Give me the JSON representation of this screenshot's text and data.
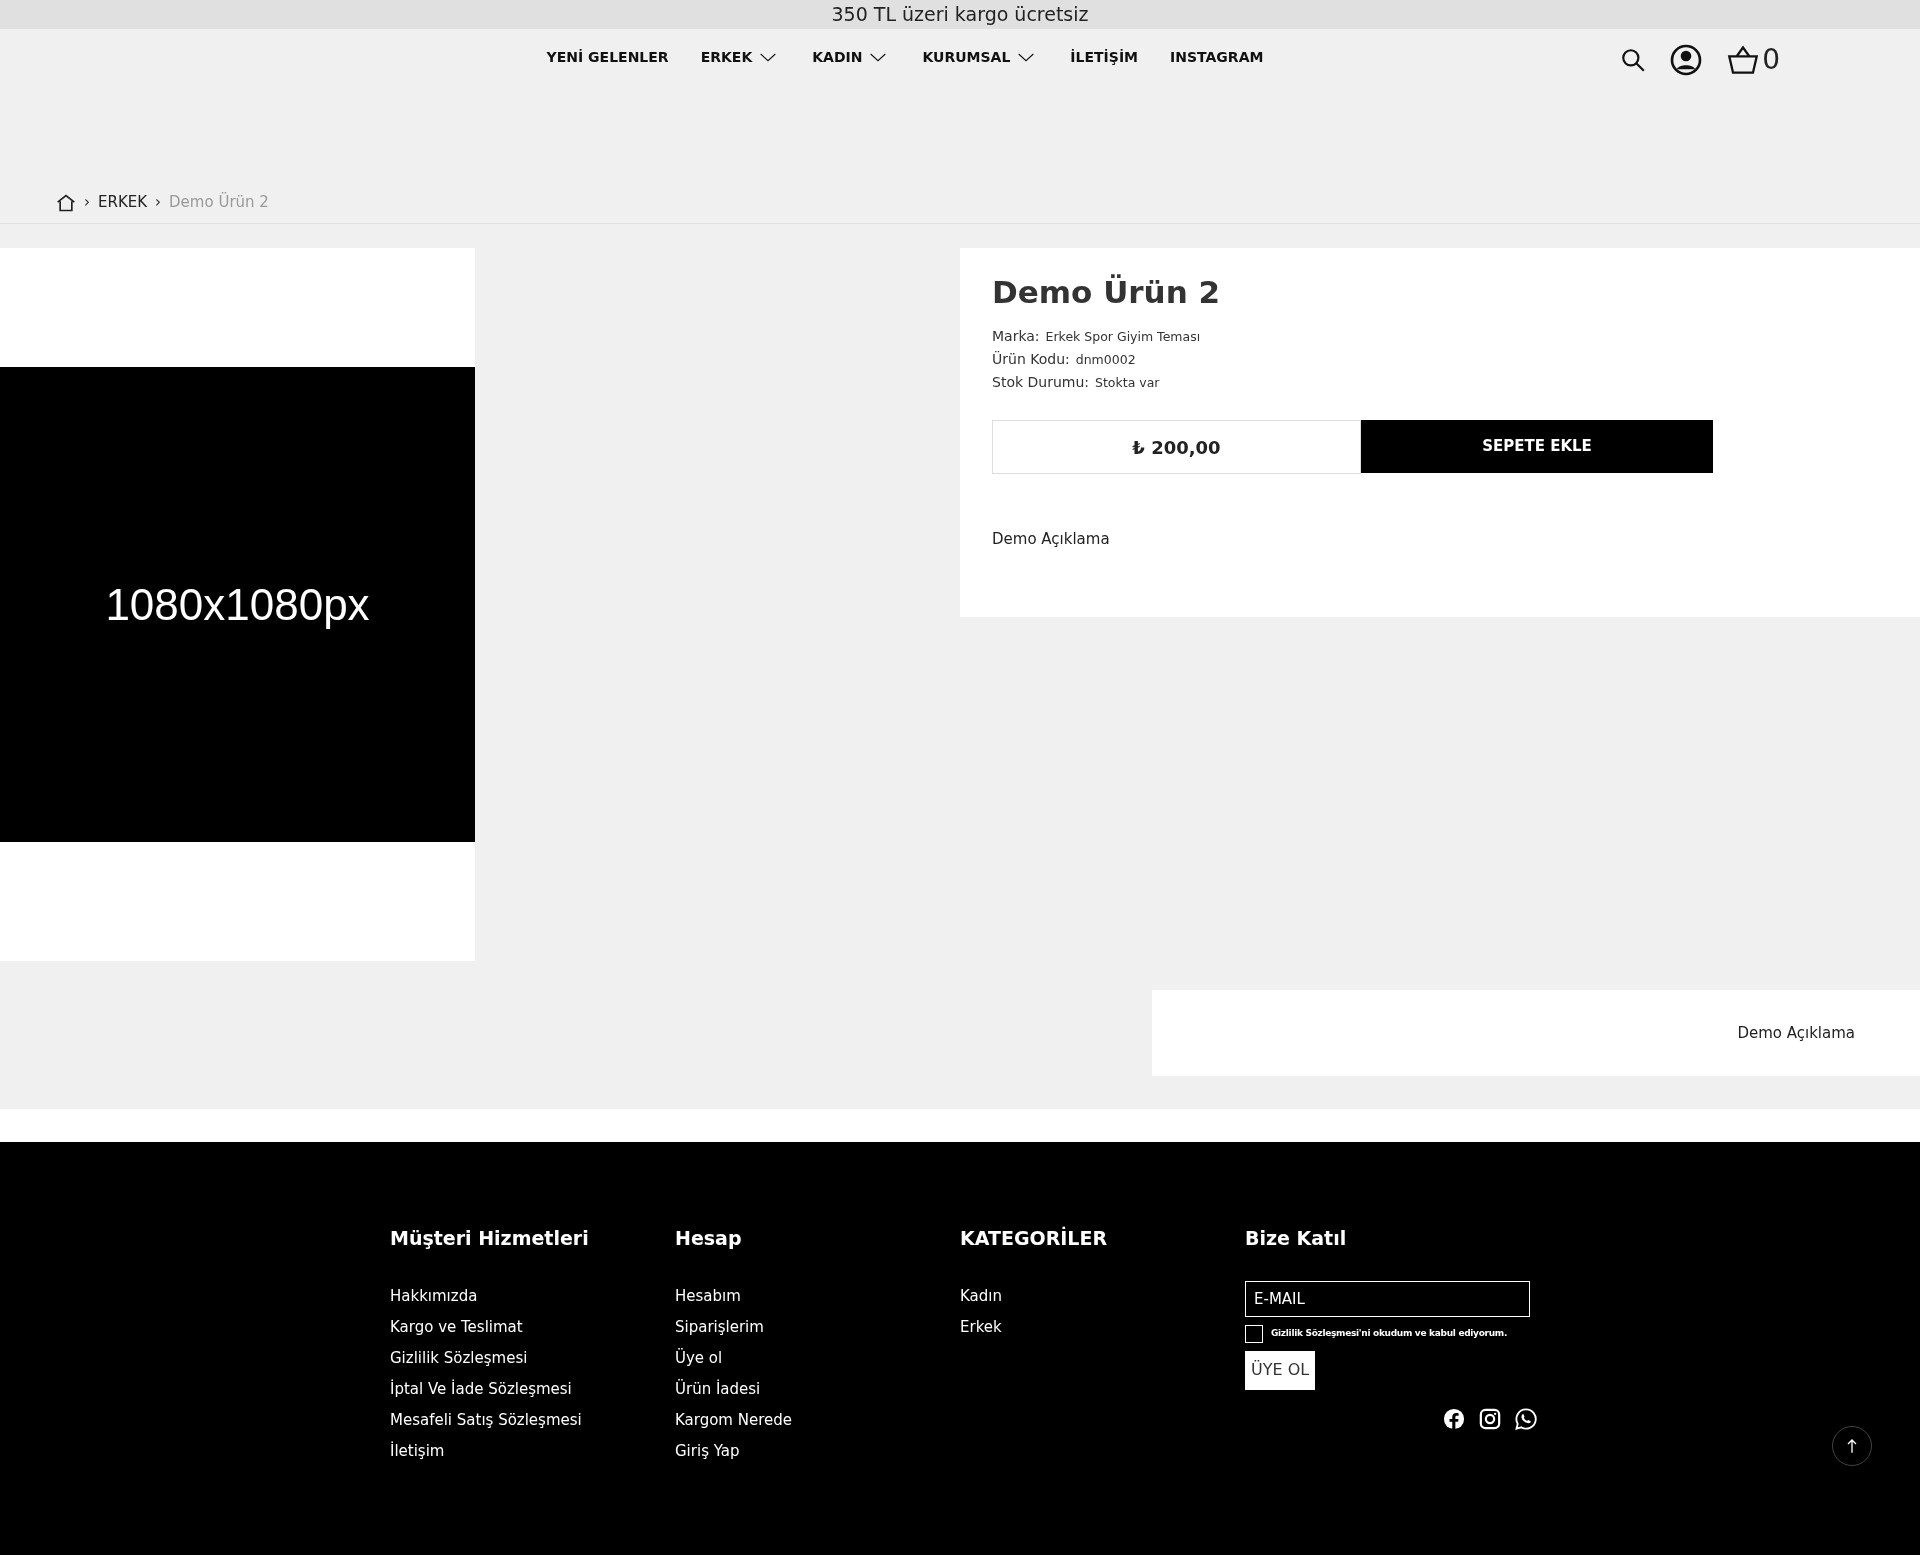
{
  "announcement": "350 TL üzeri kargo ücretsiz",
  "nav": [
    {
      "label": "YENİ GELENLER",
      "has_dropdown": false
    },
    {
      "label": "ERKEK",
      "has_dropdown": true
    },
    {
      "label": "KADIN",
      "has_dropdown": true
    },
    {
      "label": "KURUMSAL",
      "has_dropdown": true
    },
    {
      "label": "İLETİŞİM",
      "has_dropdown": false
    },
    {
      "label": "INSTAGRAM",
      "has_dropdown": false
    }
  ],
  "cart_count": "0",
  "breadcrumb": [
    {
      "separator": "›",
      "label": "ERKEK",
      "current": false
    },
    {
      "separator": "›",
      "label": "Demo Ürün 2",
      "current": true
    }
  ],
  "product": {
    "image_text": "1080x1080px",
    "title": "Demo Ürün 2",
    "specs": [
      {
        "label": "Marka:",
        "value": "Erkek Spor Giyim Teması"
      },
      {
        "label": "Ürün Kodu:",
        "value": "dnm0002"
      },
      {
        "label": "Stok Durumu:",
        "value": "Stokta var"
      }
    ],
    "price": "₺ 200,00",
    "add_to_cart": "SEPETE EKLE",
    "short_description": "Demo Açıklama"
  },
  "description_panel": "Demo Açıklama",
  "footer": {
    "columns": [
      {
        "title": "Müşteri Hizmetleri",
        "links": [
          "Hakkımızda",
          "Kargo ve Teslimat",
          "Gizlilik Sözleşmesi",
          "İptal Ve İade Sözleşmesi",
          "Mesafeli Satış Sözleşmesi",
          "İletişim"
        ]
      },
      {
        "title": "Hesap",
        "links": [
          "Hesabım",
          "Siparişlerim",
          "Üye ol",
          "Ürün İadesi",
          "Kargom Nerede",
          "Giriş Yap"
        ]
      },
      {
        "title": "KATEGORİLER",
        "links": [
          "Kadın",
          "Erkek"
        ]
      }
    ],
    "newsletter": {
      "title": "Bize Katıl",
      "placeholder": "E-MAIL",
      "consent": "Gizlilik Sözleşmesi'ni okudum ve kabul ediyorum.",
      "consent_checked": false,
      "button": "ÜYE OL"
    }
  }
}
